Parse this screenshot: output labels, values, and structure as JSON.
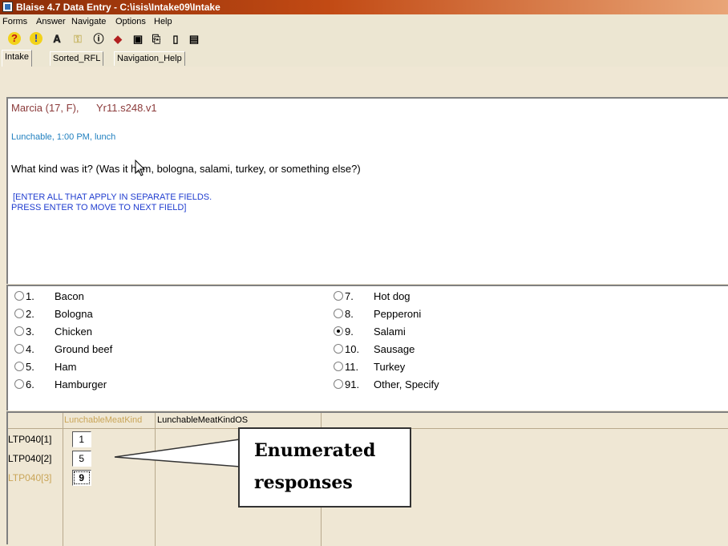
{
  "window": {
    "title": "Blaise 4.7 Data Entry - C:\\isis\\Intake09\\Intake"
  },
  "menu": [
    "Forms",
    "Answer",
    "Navigate",
    "Options",
    "Help"
  ],
  "toolbar": {
    "icons": [
      "help-question-icon",
      "exclamation-icon",
      "paperclip-icon",
      "key-icon",
      "info-icon",
      "diamond-icon",
      "binoculars-icon",
      "copy-icon",
      "new-document-icon",
      "save-disk-icon"
    ]
  },
  "tabs": [
    "Intake",
    "Sorted_RFL",
    "Navigation_Help"
  ],
  "question": {
    "respondent": "Marcia (17, F),",
    "version": "Yr11.s248.v1",
    "food": "Lunchable, 1:00 PM, lunch",
    "text": "What kind was it? (Was it ham, bologna, salami, turkey, or something else?)",
    "instruction_1": "[ENTER ALL THAT APPLY IN SEPARATE FIELDS.",
    "instruction_2": "PRESS ENTER TO MOVE TO NEXT FIELD]"
  },
  "answers": {
    "left": [
      {
        "code": "1.",
        "label": "Bacon",
        "selected": false
      },
      {
        "code": "2.",
        "label": "Bologna",
        "selected": false
      },
      {
        "code": "3.",
        "label": "Chicken",
        "selected": false
      },
      {
        "code": "4.",
        "label": "Ground beef",
        "selected": false
      },
      {
        "code": "5.",
        "label": "Ham",
        "selected": false
      },
      {
        "code": "6.",
        "label": "Hamburger",
        "selected": false
      }
    ],
    "right": [
      {
        "code": "7.",
        "label": "Hot dog",
        "selected": false
      },
      {
        "code": "8.",
        "label": "Pepperoni",
        "selected": false
      },
      {
        "code": "9.",
        "label": "Salami",
        "selected": true
      },
      {
        "code": "10.",
        "label": "Sausage",
        "selected": false
      },
      {
        "code": "11.",
        "label": "Turkey",
        "selected": false
      },
      {
        "code": "91.",
        "label": "Other, Specify",
        "selected": false
      }
    ]
  },
  "grid": {
    "col1": "LunchableMeatKind",
    "col2": "LunchableMeatKindOS",
    "rows": [
      {
        "label": "LTP040[1]",
        "value": "1"
      },
      {
        "label": "LTP040[2]",
        "value": "5"
      },
      {
        "label": "LTP040[3]",
        "value": "9"
      }
    ]
  },
  "callout": {
    "line1": "Enumerated",
    "line2": "responses"
  },
  "colors": {
    "respondent": "#8b3a3a",
    "food": "#1f7fbf",
    "instruction": "#1f3ccf",
    "inactive_header": "#c9a558",
    "active_row_label": "#c9a558"
  }
}
